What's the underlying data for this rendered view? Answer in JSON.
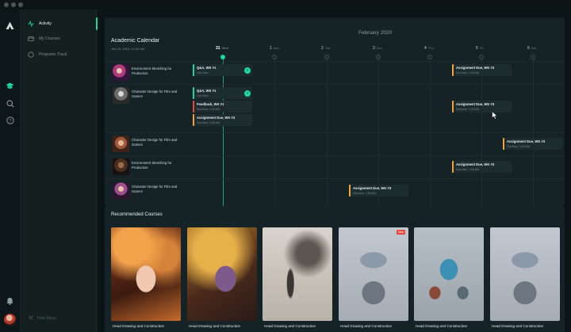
{
  "app": {
    "colors": {
      "accent": "#1fd6a0",
      "due": "#f0a33b",
      "badge": "#e6453a"
    }
  },
  "sidebar": {
    "items": [
      {
        "label": "Activity",
        "icon": "activity-icon",
        "active": true
      },
      {
        "label": "My Courses",
        "icon": "courses-icon",
        "active": false
      },
      {
        "label": "Programs Track",
        "icon": "program-track-icon",
        "active": false
      }
    ],
    "hide_label": "Hide Menu"
  },
  "calendar": {
    "title": "Academic Calendar",
    "current_datetime": "Jan 24, 2016, 12:46 AM",
    "month": "February 2020",
    "days": [
      {
        "num": "31",
        "wd": "Wed",
        "today": true
      },
      {
        "num": "1",
        "wd": "Mon",
        "today": false
      },
      {
        "num": "2",
        "wd": "Tue",
        "today": false
      },
      {
        "num": "3",
        "wd": "Sun",
        "today": false
      },
      {
        "num": "4",
        "wd": "Thu",
        "today": false
      },
      {
        "num": "5",
        "wd": "Fri",
        "today": false
      },
      {
        "num": "6",
        "wd": "Sat",
        "today": false
      }
    ],
    "rows": [
      {
        "course": "Environment Sketching for Production",
        "events": [
          {
            "title": "Q&A, WK #1",
            "subtitle": "Live Now",
            "type": "live",
            "day": 0,
            "action": true
          },
          {
            "title": "Assignment Due, WK #3",
            "subtitle": "Due time: 1:00 AM",
            "type": "due",
            "day": 5
          }
        ]
      },
      {
        "course": "Character Design for Film and Games",
        "events": [
          {
            "title": "Q&A, WK #1",
            "subtitle": "Live Now",
            "type": "live",
            "day": 0,
            "action": true
          },
          {
            "title": "Feedback, WK #1",
            "subtitle": "Due time: 1:00 AM",
            "type": "due",
            "day": 0,
            "slot": 1
          },
          {
            "title": "Assignment Due, WK #3",
            "subtitle": "Due time: 1:00 AM",
            "type": "due",
            "day": 0,
            "slot": 2
          },
          {
            "title": "Assignment Due, WK #3",
            "subtitle": "Due time: 1:00 AM",
            "type": "due",
            "day": 5
          }
        ]
      },
      {
        "course": "Character Design for Film and Games",
        "events": [
          {
            "title": "Assignment Due, WK #3",
            "subtitle": "Due time: 1:00 AM",
            "type": "due",
            "day": 6
          }
        ]
      },
      {
        "course": "Environment Sketching for Production",
        "events": [
          {
            "title": "Assignment Due, WK #3",
            "subtitle": "Due time: 1:00 AM",
            "type": "due",
            "day": 5
          }
        ]
      },
      {
        "course": "Character Design for Film and Games",
        "events": [
          {
            "title": "Assignment Due, WK #3",
            "subtitle": "Due time: 1:00 AM",
            "type": "due",
            "day": 3
          }
        ]
      }
    ]
  },
  "recommended": {
    "title": "Recommended Courses",
    "cards": [
      {
        "name": "Head Drawing and Construction",
        "art": "fantasy-portrait",
        "badge": ""
      },
      {
        "name": "Head Drawing and Construction",
        "art": "armored-titan",
        "badge": ""
      },
      {
        "name": "Head Drawing and Construction",
        "art": "pencil-sketch",
        "badge": ""
      },
      {
        "name": "Head Drawing and Construction",
        "art": "merchant-cart",
        "badge": "New"
      },
      {
        "name": "Head Drawing and Construction",
        "art": "robot-character",
        "badge": ""
      },
      {
        "name": "Head Drawing and Construction",
        "art": "merchant-cart",
        "badge": ""
      }
    ]
  }
}
